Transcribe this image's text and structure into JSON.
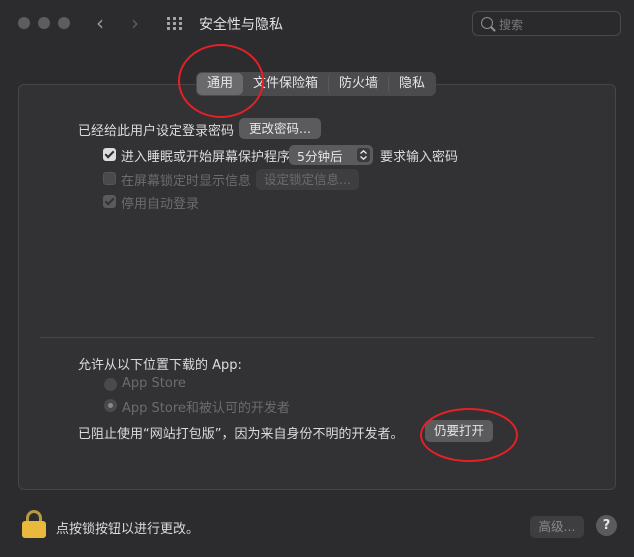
{
  "window": {
    "title": "安全性与隐私",
    "search_placeholder": "搜索"
  },
  "tabs": [
    {
      "label": "通用",
      "active": true
    },
    {
      "label": "文件保险箱",
      "active": false
    },
    {
      "label": "防火墙",
      "active": false
    },
    {
      "label": "隐私",
      "active": false
    }
  ],
  "general": {
    "password_set_label": "已经给此用户设定登录密码",
    "change_password_button": "更改密码...",
    "require_password": {
      "checked": true,
      "label_before": "进入睡眠或开始屏幕保护程序",
      "delay_value": "5分钟后",
      "label_after": "要求输入密码"
    },
    "show_message": {
      "checked": false,
      "enabled": false,
      "label": "在屏幕锁定时显示信息",
      "button": "设定锁定信息..."
    },
    "disable_auto_login": {
      "checked": true,
      "enabled": false,
      "label": "停用自动登录"
    }
  },
  "downloads": {
    "heading": "允许从以下位置下载的 App:",
    "options": [
      {
        "label": "App Store",
        "selected": false
      },
      {
        "label": "App Store和被认可的开发者",
        "selected": true
      }
    ],
    "blocked_message": "已阻止使用“网站打包版”，因为来自身份不明的开发者。",
    "open_anyway_button": "仍要打开"
  },
  "footer": {
    "lock_label": "点按锁按钮以进行更改。",
    "advanced_button": "高级...",
    "help_button": "?"
  },
  "colors": {
    "annotation": "#e42127",
    "lock": "#e8b93c"
  }
}
